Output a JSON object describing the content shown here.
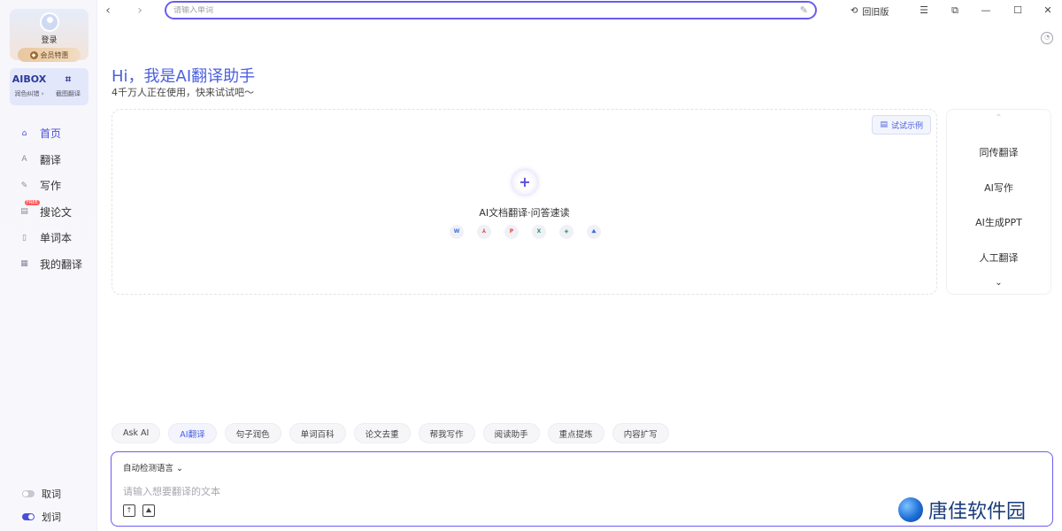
{
  "sidebar": {
    "login_label": "登录",
    "vip_label": "会员特惠",
    "tools": [
      {
        "icon_text": "AIBOX",
        "label": "润色纠错 ›"
      },
      {
        "icon_text": "⌗",
        "label": "截图翻译"
      }
    ],
    "nav": [
      {
        "label": "首页",
        "icon": "home-icon",
        "glyph": "⌂"
      },
      {
        "label": "翻译",
        "icon": "translate-icon",
        "glyph": "A"
      },
      {
        "label": "写作",
        "icon": "pen-icon",
        "glyph": "✎"
      },
      {
        "label": "搜论文",
        "icon": "paper-icon",
        "glyph": "▤",
        "badge": "FREE"
      },
      {
        "label": "单词本",
        "icon": "wordbook-icon",
        "glyph": "▯"
      },
      {
        "label": "我的翻译",
        "icon": "my-translation-icon",
        "glyph": "▦"
      }
    ],
    "toggles": [
      {
        "label": "取词",
        "on": false
      },
      {
        "label": "划词",
        "on": true
      }
    ]
  },
  "topbar": {
    "search_placeholder": "请输入单词",
    "old_version_label": "回旧版"
  },
  "hero": {
    "title": "Hi，我是AI翻译助手",
    "subtitle": "4千万人正在使用，快来试试吧～"
  },
  "upload": {
    "example_label": "试试示例",
    "label": "AI文档翻译·问答速读",
    "formats": [
      {
        "name": "word-icon",
        "glyph": "W",
        "color": "#3a6fe0"
      },
      {
        "name": "pdf-icon",
        "glyph": "⅄",
        "color": "#e0463a"
      },
      {
        "name": "ppt-icon",
        "glyph": "P",
        "color": "#e0463a"
      },
      {
        "name": "excel-icon",
        "glyph": "X",
        "color": "#2a9a5a"
      },
      {
        "name": "web-icon",
        "glyph": "◈",
        "color": "#2a9a5a"
      },
      {
        "name": "image-icon",
        "glyph": "⛰",
        "color": "#3a6fe0"
      }
    ]
  },
  "features": [
    "同传翻译",
    "AI写作",
    "AI生成PPT",
    "人工翻译"
  ],
  "chips": [
    {
      "label": "Ask AI",
      "active": false
    },
    {
      "label": "AI翻译",
      "active": true
    },
    {
      "label": "句子润色",
      "active": false
    },
    {
      "label": "单词百科",
      "active": false
    },
    {
      "label": "论文去重",
      "active": false
    },
    {
      "label": "帮我写作",
      "active": false
    },
    {
      "label": "阅读助手",
      "active": false
    },
    {
      "label": "重点提炼",
      "active": false
    },
    {
      "label": "内容扩写",
      "active": false
    }
  ],
  "translate": {
    "language_label": "自动检测语言 ⌄",
    "placeholder": "请输入想要翻译的文本"
  },
  "watermark": "唐佳软件园",
  "colors": {
    "accent": "#4b5fe0",
    "border_accent": "#6a5cf0"
  }
}
